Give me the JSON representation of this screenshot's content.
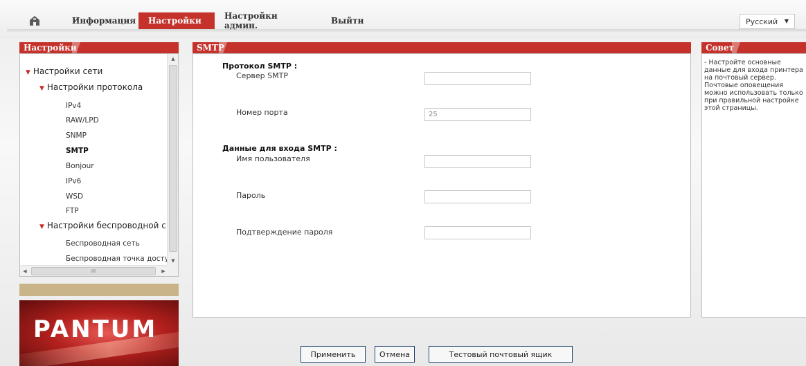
{
  "nav": {
    "home_label": "",
    "items": [
      {
        "label": "Информация"
      },
      {
        "label": "Настройки"
      },
      {
        "label": "Настройки админ."
      },
      {
        "label": "Выйти"
      }
    ],
    "language": "Русский"
  },
  "sidebar": {
    "title": "Настройки",
    "network": "Настройки сети",
    "protocol": "Настройки протокола",
    "protocol_items": [
      "IPv4",
      "RAW/LPD",
      "SNMP",
      "SMTP",
      "Bonjour",
      "IPv6",
      "WSD",
      "FTP"
    ],
    "wireless": "Настройки беспроводной с",
    "wireless_items": [
      "Беспроводная сеть",
      "Беспроводная точка достуı"
    ],
    "scroll_mark": "III"
  },
  "brand": {
    "logo": "PANTUM"
  },
  "main": {
    "title": "SMTP",
    "protocol_section": "Протокол SMTP :",
    "server_label": "Сервер SMTP",
    "server_value": "",
    "port_label": "Номер порта",
    "port_value": "25",
    "login_section": "Данные для входа SMTP :",
    "user_label": "Имя пользователя",
    "user_value": "",
    "password_label": "Пароль",
    "password_value": "",
    "confirm_label": "Подтверждение пароля",
    "confirm_value": ""
  },
  "tip": {
    "title": "Совет",
    "text": "- Настройте основные данные для входа принтера на почтовый сервер. Почтовые оповещения можно использовать только при правильной настройке этой страницы."
  },
  "buttons": {
    "apply": "Применить",
    "cancel": "Отмена",
    "test": "Тестовый почтовый ящик"
  },
  "colors": {
    "accent": "#c5322b",
    "tan": "#c9b48a"
  }
}
